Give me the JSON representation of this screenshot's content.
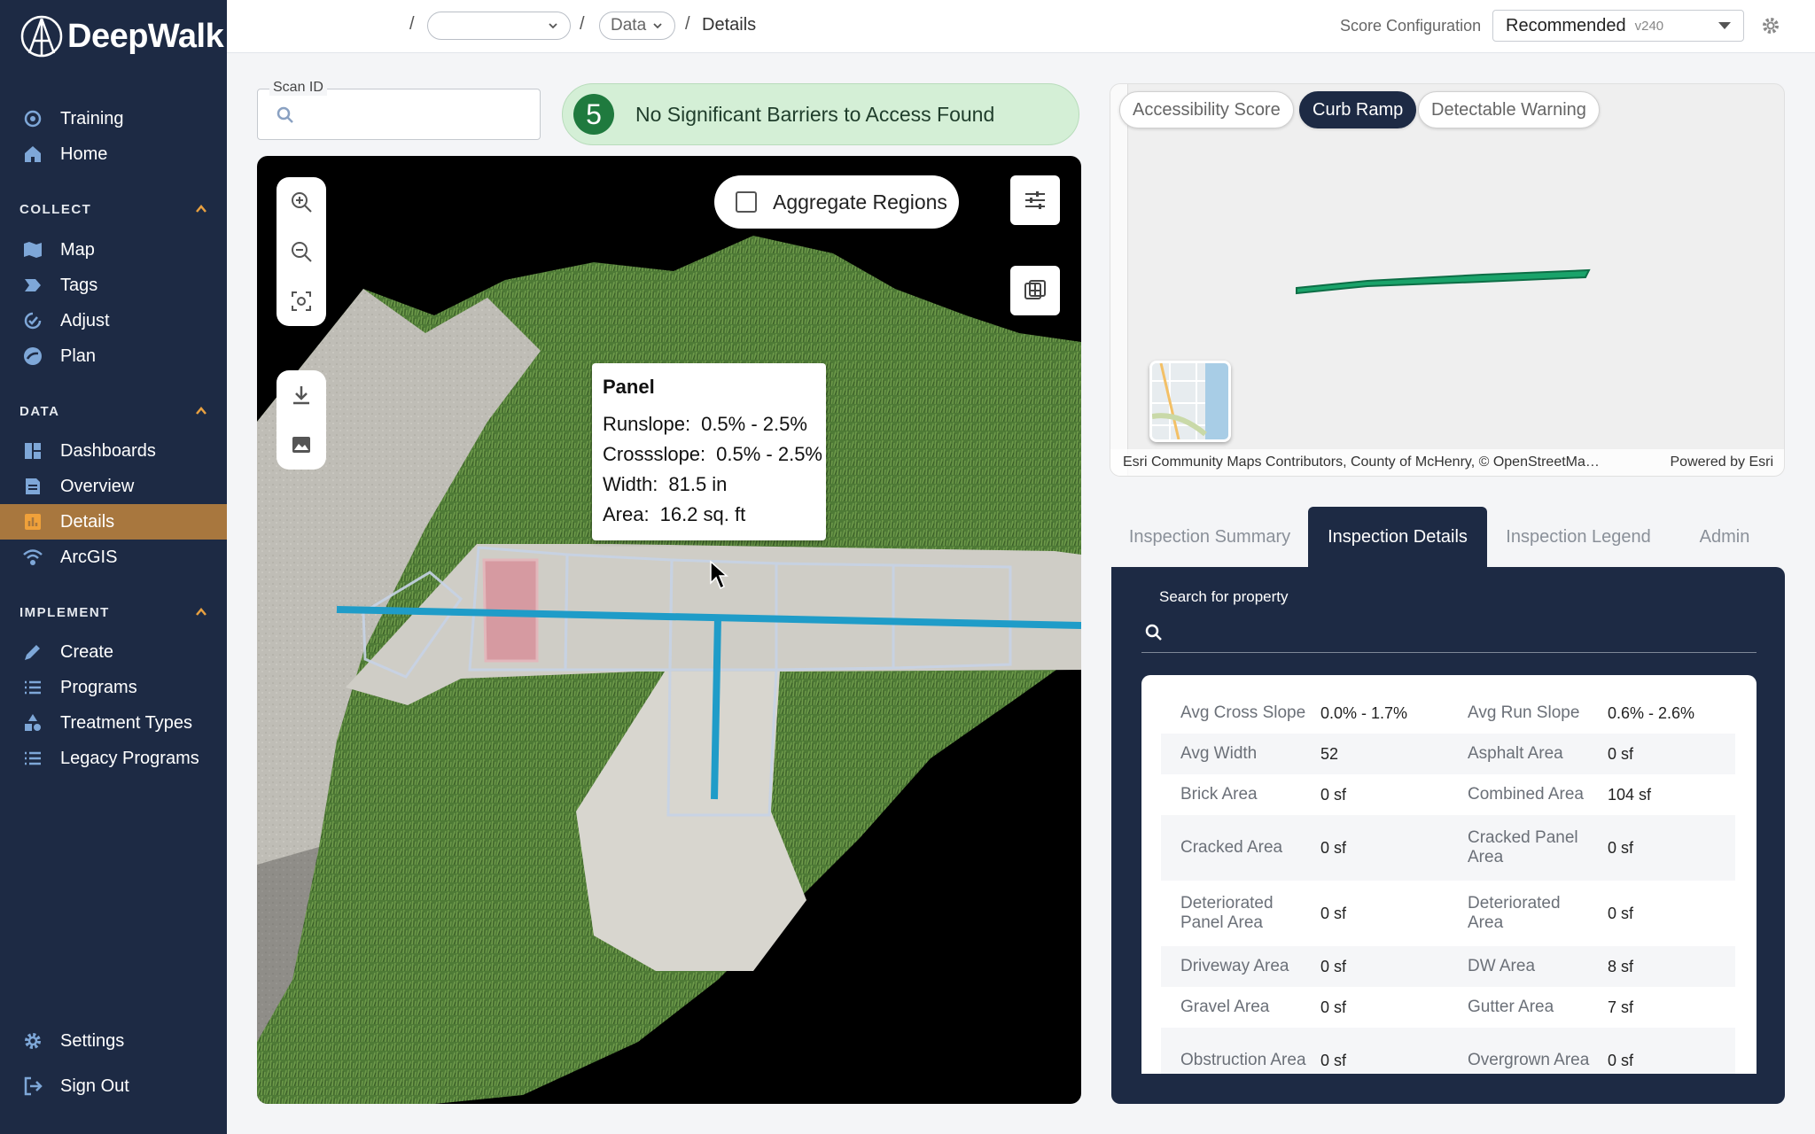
{
  "brand": {
    "name": "DeepWalk"
  },
  "colors": {
    "sidebar": "#1d2a44",
    "active_nav": "#a8773e",
    "accent_green": "#1f7a3e",
    "route_green": "#1aa36a",
    "overlay_blue": "#1f9cc8"
  },
  "sidebar": {
    "top_items": [
      {
        "label": "Training",
        "icon": "training-icon"
      },
      {
        "label": "Home",
        "icon": "home-icon"
      }
    ],
    "sections": [
      {
        "title": "COLLECT",
        "items": [
          {
            "label": "Map",
            "icon": "map-icon"
          },
          {
            "label": "Tags",
            "icon": "tag-icon"
          },
          {
            "label": "Adjust",
            "icon": "adjust-icon"
          },
          {
            "label": "Plan",
            "icon": "plan-icon"
          }
        ]
      },
      {
        "title": "DATA",
        "items": [
          {
            "label": "Dashboards",
            "icon": "dashboard-icon"
          },
          {
            "label": "Overview",
            "icon": "overview-icon"
          },
          {
            "label": "Details",
            "icon": "details-icon",
            "active": true
          },
          {
            "label": "ArcGIS",
            "icon": "arcgis-icon"
          }
        ]
      },
      {
        "title": "IMPLEMENT",
        "items": [
          {
            "label": "Create",
            "icon": "create-icon"
          },
          {
            "label": "Programs",
            "icon": "list-icon"
          },
          {
            "label": "Treatment Types",
            "icon": "shapes-icon"
          },
          {
            "label": "Legacy Programs",
            "icon": "list-icon"
          }
        ]
      }
    ],
    "bottom_items": [
      {
        "label": "Settings",
        "icon": "gear-icon"
      },
      {
        "label": "Sign Out",
        "icon": "sign-out-icon"
      }
    ]
  },
  "topbar": {
    "breadcrumb": {
      "sep": "/",
      "project_value": "",
      "data_label": "Data",
      "current": "Details"
    },
    "score_config_label": "Score Configuration",
    "score_config_value": "Recommended",
    "score_config_version": "v240"
  },
  "scan": {
    "label": "Scan ID",
    "value": ""
  },
  "banner": {
    "score": "5",
    "text": "No Significant Barriers to Access Found"
  },
  "viewer": {
    "aggregate_label": "Aggregate Regions",
    "aggregate_checked": false,
    "tooltip": {
      "title": "Panel",
      "rows": [
        {
          "label": "Runslope:",
          "value": "0.5% - 2.5%"
        },
        {
          "label": "Crossslope:",
          "value": "0.5% - 2.5%"
        },
        {
          "label": "Width:",
          "value": "81.5 in"
        },
        {
          "label": "Area:",
          "value": "16.2 sq. ft"
        }
      ]
    }
  },
  "minimap": {
    "chips": [
      "Accessibility Score",
      "Curb Ramp",
      "Detectable Warning"
    ],
    "active_chip": "Curb Ramp",
    "attribution": "Esri Community Maps Contributors, County of McHenry, © OpenStreetMa…",
    "powered_by": "Powered by Esri"
  },
  "tabs": [
    "Inspection Summary",
    "Inspection Details",
    "Inspection Legend",
    "Admin"
  ],
  "active_tab": "Inspection Details",
  "details": {
    "search_label": "Search for property",
    "search_value": "",
    "rows": [
      [
        {
          "k": "Avg Cross Slope",
          "v": "0.0% - 1.7%"
        },
        {
          "k": "Avg Run Slope",
          "v": "0.6% - 2.6%"
        }
      ],
      [
        {
          "k": "Avg Width",
          "v": "52"
        },
        {
          "k": "Asphalt Area",
          "v": "0 sf"
        }
      ],
      [
        {
          "k": "Brick Area",
          "v": "0 sf"
        },
        {
          "k": "Combined Area",
          "v": "104 sf"
        }
      ],
      [
        {
          "k": "Cracked Area",
          "v": "0 sf"
        },
        {
          "k": "Cracked Panel Area",
          "v": "0 sf"
        }
      ],
      [
        {
          "k": "Deteriorated Panel Area",
          "v": "0 sf"
        },
        {
          "k": "Deteriorated Area",
          "v": "0 sf"
        }
      ],
      [
        {
          "k": "Driveway Area",
          "v": "0 sf"
        },
        {
          "k": "DW Area",
          "v": "8 sf"
        }
      ],
      [
        {
          "k": "Gravel Area",
          "v": "0 sf"
        },
        {
          "k": "Gutter Area",
          "v": "7 sf"
        }
      ],
      [
        {
          "k": "Obstruction Area",
          "v": "0 sf"
        },
        {
          "k": "Overgrown Area",
          "v": "0 sf"
        }
      ]
    ]
  }
}
